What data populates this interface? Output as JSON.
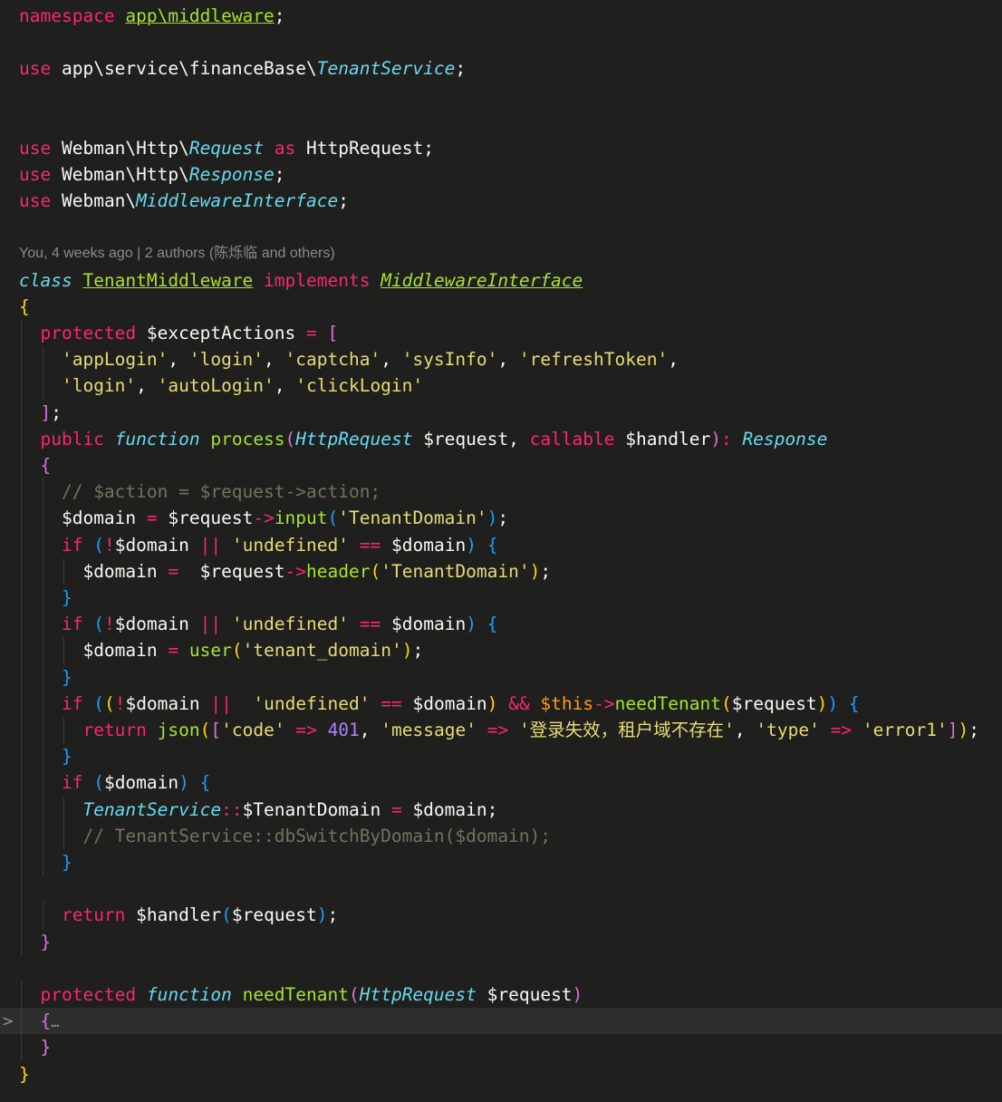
{
  "editor": {
    "file_lines": [
      "namespace app\\middleware;",
      "use app\\service\\financeBase\\TenantService;",
      "use Webman\\Http\\Request as HttpRequest;",
      "use Webman\\Http\\Response;",
      "use Webman\\MiddlewareInterface;",
      "class TenantMiddleware implements MiddlewareInterface"
    ],
    "blame": "You, 4 weeks ago | 2 authors (陈烁临 and others)",
    "fold_marker": ">",
    "fold_ellipsis": "…",
    "colors": {
      "background": "#1f1f1e",
      "keyword": "#f92672",
      "class_type": "#66d9ef",
      "function": "#a6e22e",
      "string": "#e6db74",
      "number": "#ae81ff",
      "comment": "#75715e",
      "bracket_gold": "#ffd700",
      "bracket_purple": "#da70d6",
      "bracket_blue": "#179fff"
    },
    "tokens": {
      "namespace": "namespace",
      "use": "use",
      "as": "as",
      "class": "class",
      "implements": "implements",
      "protected": "protected",
      "public": "public",
      "function": "function",
      "callable": "callable",
      "if": "if",
      "return": "return",
      "ns_path": "app\\middleware",
      "svc_prefix": "app\\service\\financeBase\\",
      "TenantService": "TenantService",
      "webman_http": "Webman\\Http\\",
      "webman": "Webman\\",
      "Request": "Request",
      "HttpRequest": "HttpRequest",
      "Response": "Response",
      "MiddlewareInterface": "MiddlewareInterface",
      "TenantMiddleware": "TenantMiddleware",
      "exceptActions": "$exceptActions",
      "s_appLogin": "'appLogin'",
      "s_login": "'login'",
      "s_captcha": "'captcha'",
      "s_sysInfo": "'sysInfo'",
      "s_refreshToken": "'refreshToken'",
      "s_autoLogin": "'autoLogin'",
      "s_clickLogin": "'clickLogin'",
      "process": "process",
      "request_var": "$request",
      "handler_var": "$handler",
      "comment_action": "// $action = $request->action;",
      "domain_var": "$domain",
      "input": "input",
      "header": "header",
      "s_TenantDomain": "'TenantDomain'",
      "s_undefined": "'undefined'",
      "user": "user",
      "s_tenant_domain": "'tenant_domain'",
      "this": "$this",
      "needTenant": "needTenant",
      "json": "json",
      "s_code": "'code'",
      "n_401": "401",
      "s_message": "'message'",
      "s_msg_cn": "'登录失效，租户域不存在'",
      "s_type": "'type'",
      "s_error1": "'error1'",
      "static_prop": "$TenantDomain",
      "comment_switch": "// TenantService::dbSwitchByDomain($domain);"
    }
  }
}
